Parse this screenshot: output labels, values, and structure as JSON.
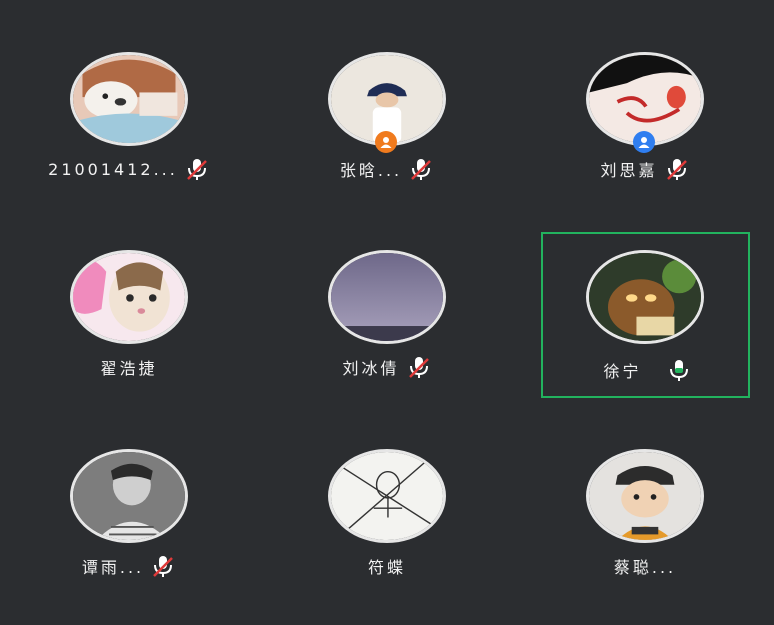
{
  "participants": [
    {
      "name": "21001412...",
      "mic": "muted",
      "role_badge": "",
      "avatar": "cartoon bear in scarf"
    },
    {
      "name": "张晗...",
      "mic": "muted",
      "role_badge": "host",
      "avatar": "person in bucket hat"
    },
    {
      "name": "刘思嘉",
      "mic": "muted",
      "role_badge": "co-host",
      "avatar": "cartoon face"
    },
    {
      "name": "翟浩捷",
      "mic": "none",
      "role_badge": "",
      "avatar": "cat"
    },
    {
      "name": "刘冰倩",
      "mic": "muted",
      "role_badge": "",
      "avatar": "purple sky"
    },
    {
      "name": "徐宁",
      "mic": "active",
      "role_badge": "",
      "avatar": "cartoon bear"
    },
    {
      "name": "谭雨...",
      "mic": "muted",
      "role_badge": "",
      "avatar": "black and white photo"
    },
    {
      "name": "符蝶",
      "mic": "none",
      "role_badge": "",
      "avatar": "stick figure sketch"
    },
    {
      "name": "蔡聪...",
      "mic": "none",
      "role_badge": "",
      "avatar": "cartoon boy in cap"
    }
  ],
  "colors": {
    "background": "#2b2d30",
    "speaking_border": "#22b35e",
    "host_badge": "#f07b1e",
    "cohost_badge": "#2f7ef0",
    "muted_slash": "#e03a3a",
    "mic_icon": "#ffffff"
  }
}
